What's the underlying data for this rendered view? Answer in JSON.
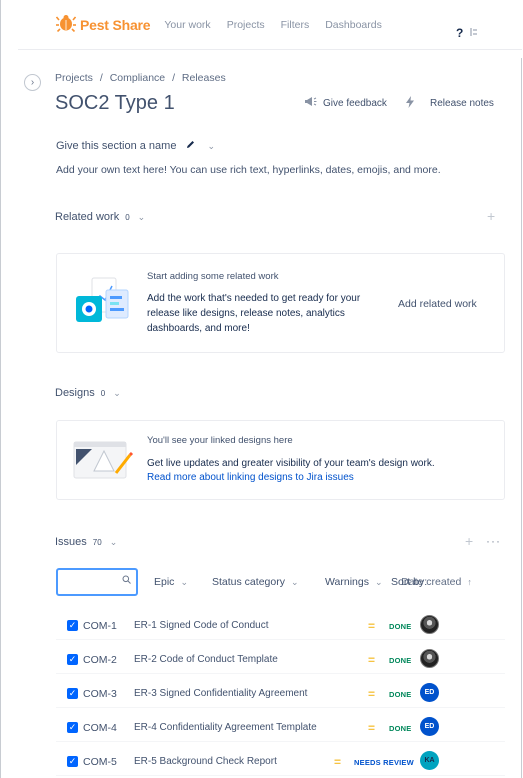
{
  "nav": {
    "brand": "Pest Share",
    "items": [
      "Your work",
      "Projects",
      "Filters",
      "Dashboards"
    ],
    "help": "?"
  },
  "header": {
    "breadcrumb": [
      "Projects",
      "/",
      "Compliance",
      "/",
      "Releases"
    ],
    "title": "SOC2 Type 1",
    "give_feedback": "Give feedback",
    "release_notes": "Release notes"
  },
  "section": {
    "name": "Give this section a name",
    "description": "Add your own text here! You can use rich text, hyperlinks, dates, emojis, and more."
  },
  "related_work": {
    "label": "Related work",
    "count": "0",
    "card_title": "Start adding some related work",
    "card_body": "Add the work that's needed to get ready for your release like designs, release notes, analytics dashboards, and more!",
    "add_button": "Add related work"
  },
  "designs": {
    "label": "Designs",
    "count": "0",
    "card_title": "You'll see your linked designs here",
    "card_body": "Get live updates and greater visibility of your team's design work.",
    "card_link": "Read more about linking designs to Jira issues"
  },
  "issues": {
    "label": "Issues",
    "count": "70",
    "filters": {
      "epic": "Epic",
      "status_category": "Status category",
      "warnings": "Warnings",
      "sort_by": "Sort by:",
      "sort_field": "Date created"
    },
    "rows": [
      {
        "key": "COM-1",
        "summary": "ER-1 Signed Code of Conduct",
        "status": "DONE",
        "avatar": ""
      },
      {
        "key": "COM-2",
        "summary": "ER-2 Code of Conduct Template",
        "status": "DONE",
        "avatar": ""
      },
      {
        "key": "COM-3",
        "summary": "ER-3 Signed Confidentiality Agreement",
        "status": "DONE",
        "avatar": "ED"
      },
      {
        "key": "COM-4",
        "summary": "ER-4 Confidentiality Agreement Template",
        "status": "DONE",
        "avatar": "ED"
      },
      {
        "key": "COM-5",
        "summary": "ER-5 Background Check Report",
        "status": "NEEDS REVIEW",
        "avatar": "KA"
      }
    ]
  },
  "colors": {
    "brand": "#f79232",
    "link": "#0052cc",
    "done": "#00875a",
    "priority_medium": "#f6c342"
  }
}
